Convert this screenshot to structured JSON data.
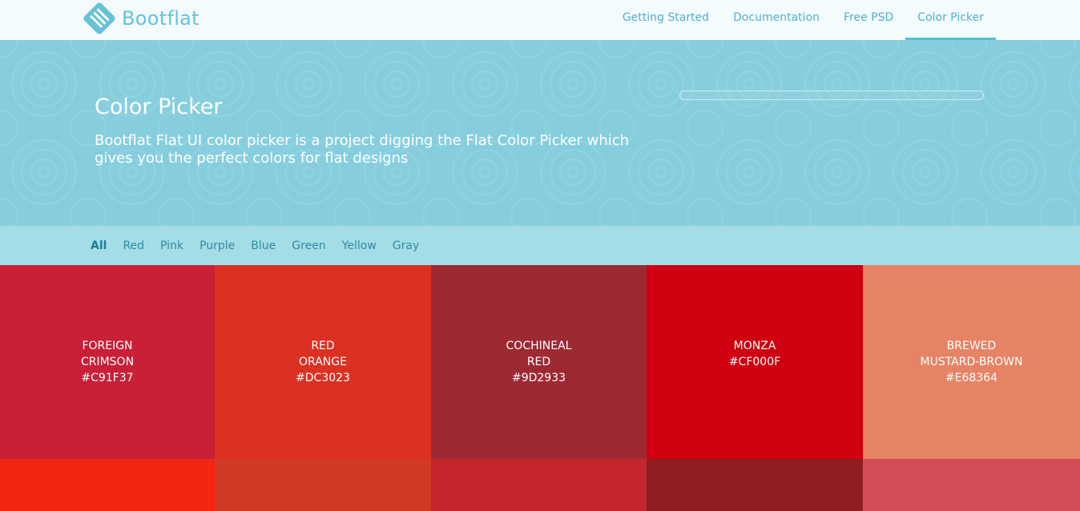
{
  "brand": {
    "name": "Bootflat",
    "logo_icon": "bootflat-logo-icon",
    "color": "#67c2d6"
  },
  "nav": [
    {
      "label": "Getting Started"
    },
    {
      "label": "Documentation"
    },
    {
      "label": "Free PSD"
    },
    {
      "label": "Color Picker",
      "active": true
    }
  ],
  "hero": {
    "title": "Color Picker",
    "description": "Bootflat Flat UI color picker is a project digging the Flat Color Picker which gives you the perfect colors for flat designs",
    "background": "#86cedd",
    "progress": 0
  },
  "filters": [
    {
      "label": "All",
      "active": true
    },
    {
      "label": "Red"
    },
    {
      "label": "Pink"
    },
    {
      "label": "Purple"
    },
    {
      "label": "Blue"
    },
    {
      "label": "Green"
    },
    {
      "label": "Yellow"
    },
    {
      "label": "Gray"
    }
  ],
  "swatches": [
    {
      "name_line1": "FOREIGN",
      "name_line2": "CRIMSON",
      "hex": "#C91F37",
      "color": "#C91F37"
    },
    {
      "name_line1": "RED",
      "name_line2": "ORANGE",
      "hex": "#DC3023",
      "color": "#DC3023"
    },
    {
      "name_line1": "COCHINEAL",
      "name_line2": "RED",
      "hex": "#9D2933",
      "color": "#9D2933"
    },
    {
      "name_line1": "MONZA",
      "name_line2": "",
      "hex": "#CF000F",
      "color": "#CF000F"
    },
    {
      "name_line1": "BREWED",
      "name_line2": "MUSTARD-BROWN",
      "hex": "#E68364",
      "color": "#E68364"
    },
    {
      "color": "#F22613"
    },
    {
      "color": "#CF3A24"
    },
    {
      "color": "#C3272B"
    },
    {
      "color": "#8F1D21"
    },
    {
      "color": "#D24D57"
    }
  ]
}
